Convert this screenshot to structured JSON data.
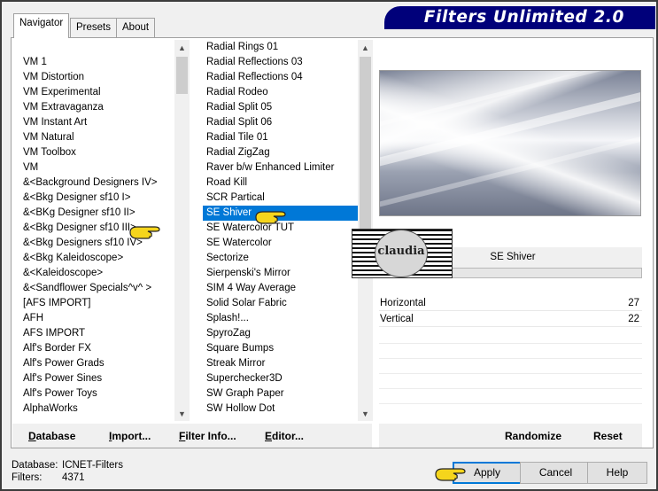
{
  "app": {
    "title": "Filters Unlimited 2.0"
  },
  "tabs": [
    {
      "label": "Navigator",
      "active": true
    },
    {
      "label": "Presets",
      "active": false
    },
    {
      "label": "About",
      "active": false
    }
  ],
  "categories": {
    "items": [
      "VM 1",
      "VM Distortion",
      "VM Experimental",
      "VM Extravaganza",
      "VM Instant Art",
      "VM Natural",
      "VM Toolbox",
      "VM",
      "&<Background Designers IV>",
      "&<Bkg Designer sf10 I>",
      "&<BKg Designer sf10 II>",
      "&<Bkg Designer sf10 III>",
      "&<Bkg Designers sf10 IV>",
      "&<Bkg Kaleidoscope>",
      "&<Kaleidoscope>",
      "&<Sandflower Specials^v^ >",
      "[AFS IMPORT]",
      "AFH",
      "AFS IMPORT",
      "Alf's Border FX",
      "Alf's Power Grads",
      "Alf's Power Sines",
      "Alf's Power Toys",
      "AlphaWorks"
    ]
  },
  "filters": {
    "items": [
      "Radial  Rings 01",
      "Radial Reflections 03",
      "Radial Reflections 04",
      "Radial Rodeo",
      "Radial Split 05",
      "Radial Split 06",
      "Radial Tile 01",
      "Radial ZigZag",
      "Raver b/w Enhanced Limiter",
      "Road Kill",
      "SCR  Partical",
      "SE Shiver",
      "SE Watercolor TUT",
      "SE Watercolor",
      "Sectorize",
      "Sierpenski's Mirror",
      "SIM 4 Way Average",
      "Solid Solar Fabric",
      "Splash!...",
      "SpyroZag",
      "Square Bumps",
      "Streak Mirror",
      "Superchecker3D",
      "SW Graph Paper",
      "SW Hollow Dot"
    ],
    "selected": "SE Shiver"
  },
  "preview": {
    "filter_name": "SE Shiver"
  },
  "params": [
    {
      "name": "Horizontal",
      "value": "27"
    },
    {
      "name": "Vertical",
      "value": "22"
    }
  ],
  "links": {
    "database": "Database",
    "import": "Import...",
    "filter_info": "Filter Info...",
    "editor": "Editor...",
    "randomize": "Randomize",
    "reset": "Reset"
  },
  "status": {
    "database_label": "Database:",
    "database_value": "ICNET-Filters",
    "filters_label": "Filters:",
    "filters_value": "4371"
  },
  "buttons": {
    "apply": "Apply",
    "cancel": "Cancel",
    "help": "Help"
  },
  "stamp": {
    "text": "claudia"
  },
  "colors": {
    "banner": "#00007a",
    "selection": "#0078d7",
    "hand": "#f5d51c"
  }
}
